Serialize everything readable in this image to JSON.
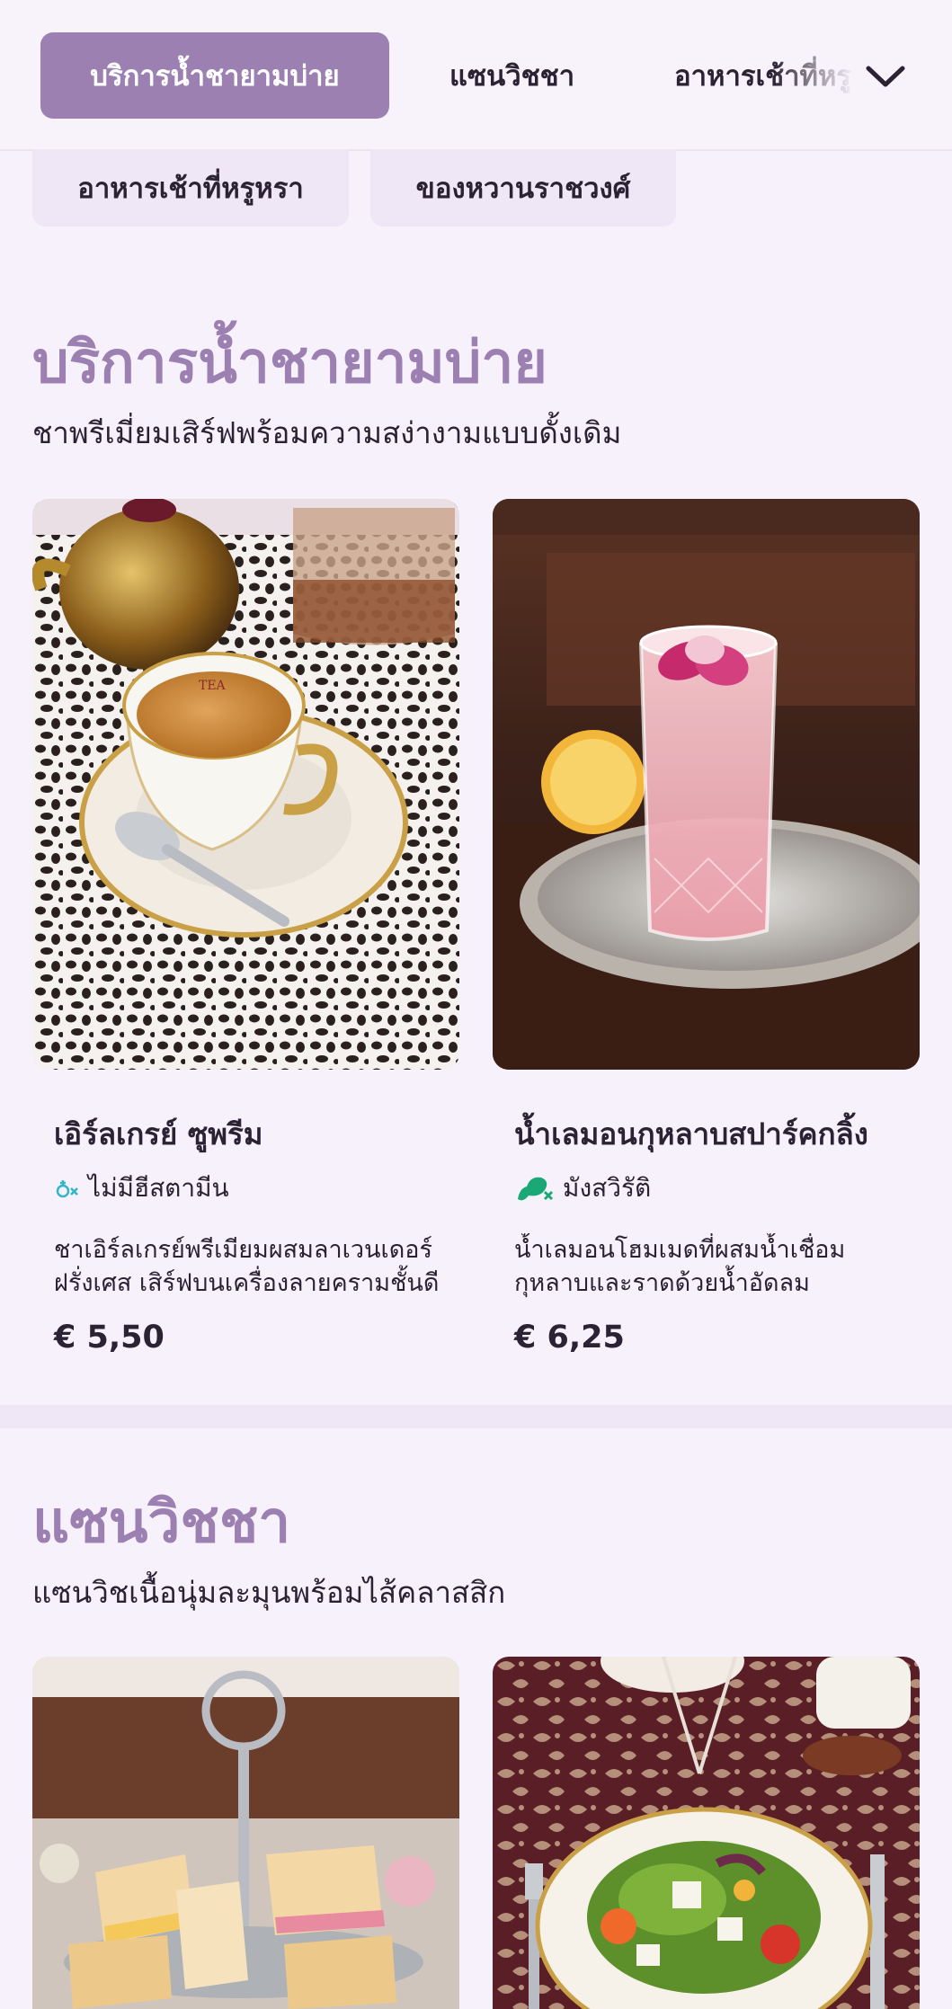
{
  "nav": {
    "active_tab": "บริการน้ำชายามบ่าย",
    "tab_2": "แซนวิชชา",
    "tab_3": "อาหารเช้าที่หรูหรา",
    "chips": [
      "อาหารเช้าที่หรูหรา",
      "ของหวานราชวงศ์"
    ]
  },
  "sections": [
    {
      "title": "บริการน้ำชายามบ่าย",
      "subtitle": "ชาพรีเมี่ยมเสิร์ฟพร้อมความสง่างามแบบดั้งเดิม",
      "items": [
        {
          "name": "เอิร์ลเกรย์ ซูพรีม",
          "tag": "ไม่มีฮีสตามีน",
          "tag_icon": "no-histamine-icon",
          "description": "ชาเอิร์ลเกรย์พรีเมียมผสมลาเวนเดอร์ฝรั่งเศส เสิร์ฟบนเครื่องลายครามชั้นดี",
          "price": "€ 5,50"
        },
        {
          "name": "น้ำเลมอนกุหลาบสปาร์คกลิ้ง",
          "tag": "มังสวิรัติ",
          "tag_icon": "no-meat-icon",
          "description": "น้ำเลมอนโฮมเมดที่ผสมน้ำเชื่อมกุหลาบและราดด้วยน้ำอัดลม",
          "price": "€ 6,25"
        }
      ]
    },
    {
      "title": "แซนวิชชา",
      "subtitle": "แซนวิชเนื้อนุ่มละมุนพร้อมไส้คลาสสิก"
    }
  ],
  "colors": {
    "accent": "#9b80b1",
    "background": "#f7f1fb",
    "chip": "#efe7f5",
    "text": "#2b2233",
    "tag_cyan": "#2fb6c8",
    "tag_green": "#1aa876"
  }
}
